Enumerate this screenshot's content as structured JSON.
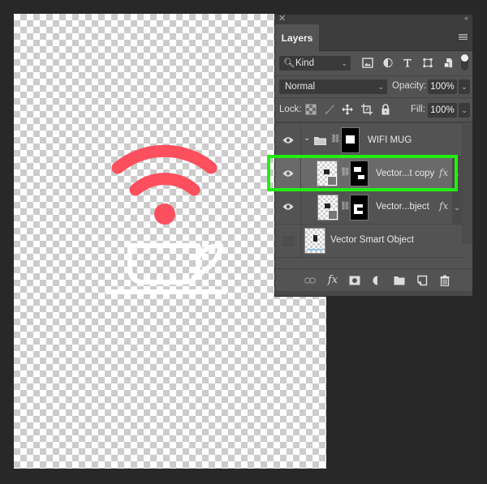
{
  "canvas": {
    "artwork": {
      "wifi_color": "#fd4f5e",
      "mug_color": "#ffffff"
    }
  },
  "panel": {
    "tab_label": "Layers",
    "close_icon": "close-icon",
    "collapse_icon": "double-chevron-left-icon",
    "menu_icon": "panel-menu-icon",
    "filter": {
      "kind_label": "Kind",
      "icons": [
        "image-filter-icon",
        "adjustment-filter-icon",
        "type-filter-icon",
        "shape-filter-icon",
        "smart-object-filter-icon"
      ]
    },
    "blend_mode": "Normal",
    "opacity_label": "Opacity:",
    "opacity_value": "100%",
    "lock_label": "Lock:",
    "lock_icons": [
      "lock-transparent-pixels-icon",
      "lock-image-pixels-icon",
      "lock-position-icon",
      "lock-artboard-icon",
      "lock-all-icon"
    ],
    "fill_label": "Fill:",
    "fill_value": "100%",
    "layers": [
      {
        "name": "WIFI MUG",
        "type": "group",
        "visible": true,
        "expanded": true
      },
      {
        "name": "Vector...t copy",
        "type": "smart-object",
        "visible": true,
        "fx": "fx",
        "selected": true
      },
      {
        "name": "Vector...bject",
        "type": "smart-object",
        "visible": true,
        "fx": "fx"
      },
      {
        "name": "Vector Smart Object",
        "type": "smart-object",
        "visible": false
      }
    ],
    "footer_icons": [
      "link-layers-icon",
      "layer-style-icon",
      "add-mask-icon",
      "adjustment-layer-icon",
      "new-group-icon",
      "new-layer-icon",
      "delete-layer-icon"
    ],
    "highlight_color": "#22ee11"
  }
}
